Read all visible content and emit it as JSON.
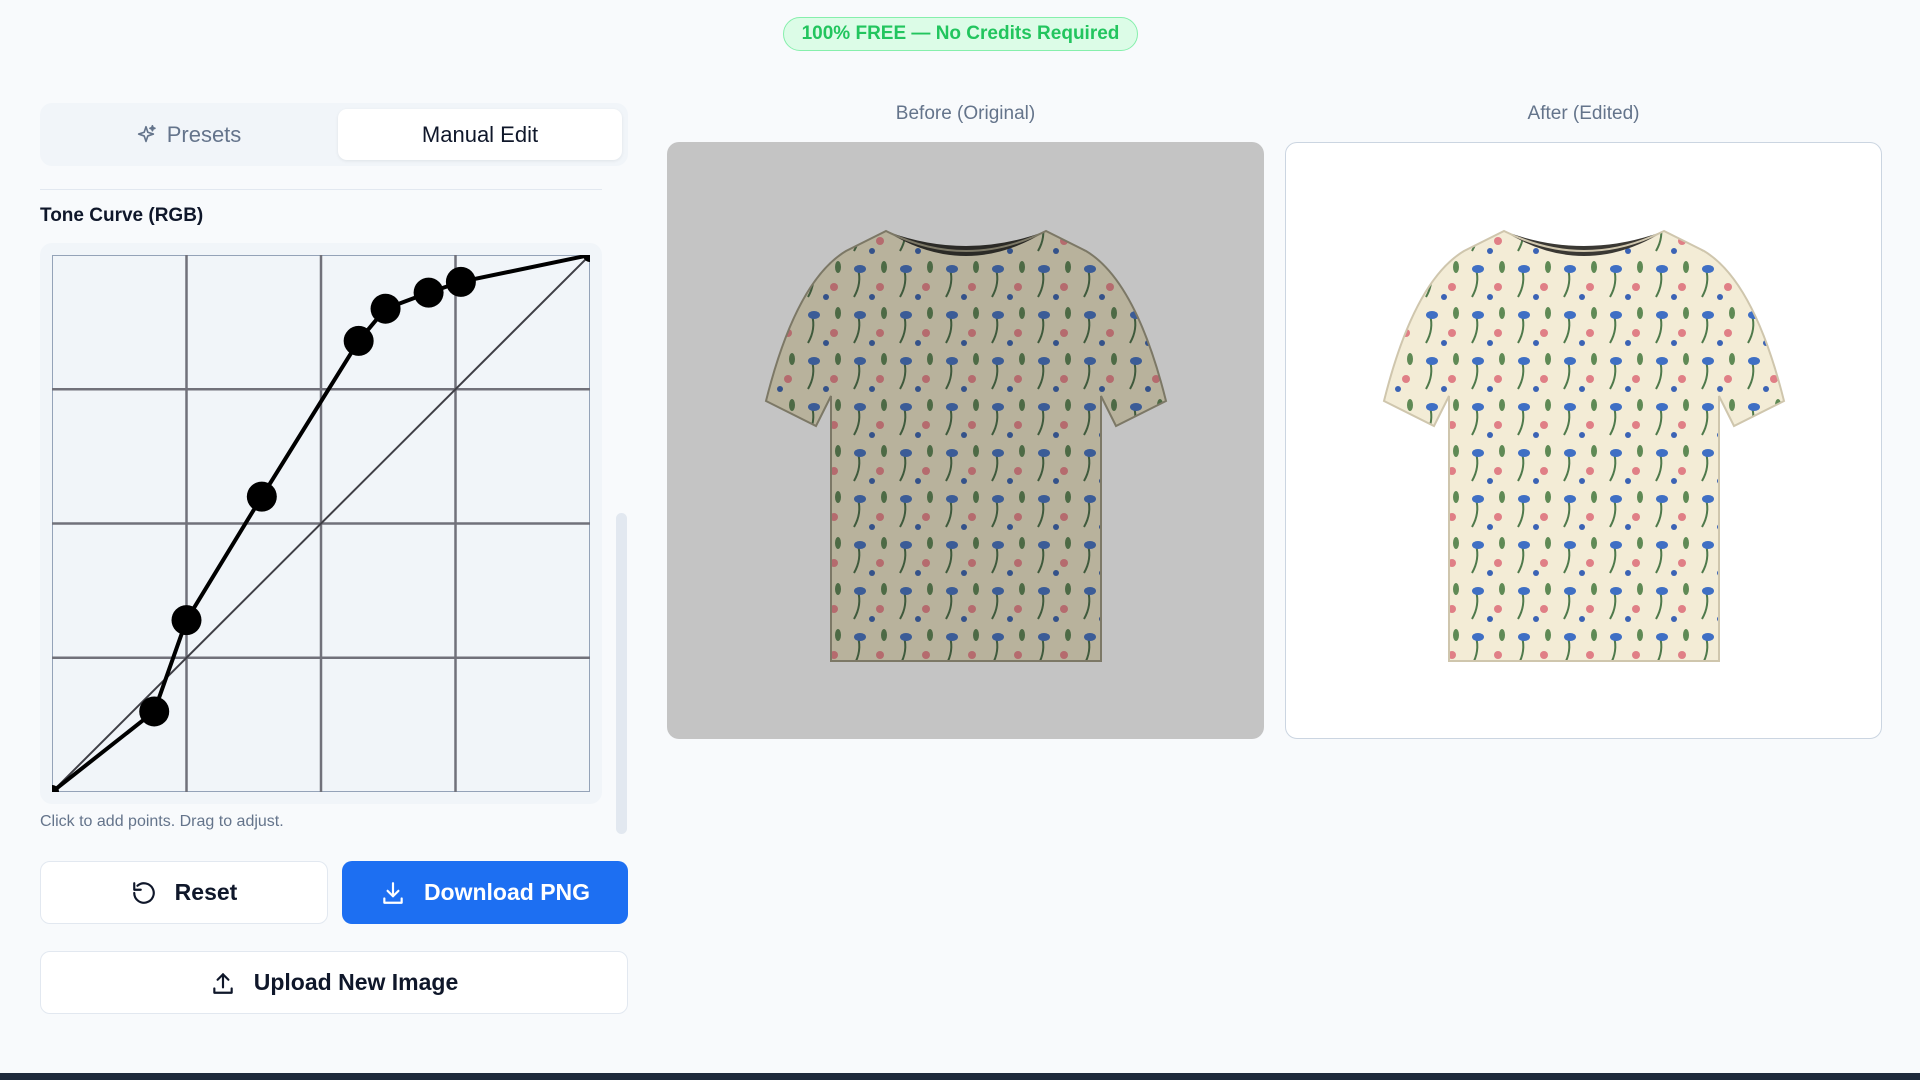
{
  "badge": {
    "text": "100% FREE — No Credits Required",
    "color": "#22c55e"
  },
  "tabs": [
    {
      "label": "Presets",
      "icon": "sparkles-icon",
      "active": false
    },
    {
      "label": "Manual Edit",
      "active": true
    }
  ],
  "tone_curve": {
    "title": "Tone Curve (RGB)",
    "hint": "Click to add points. Drag to adjust.",
    "points": [
      [
        0,
        0
      ],
      [
        0.19,
        0.15
      ],
      [
        0.25,
        0.32
      ],
      [
        0.39,
        0.55
      ],
      [
        0.57,
        0.84
      ],
      [
        0.62,
        0.9
      ],
      [
        0.7,
        0.93
      ],
      [
        0.76,
        0.95
      ],
      [
        1,
        1
      ]
    ]
  },
  "actions": {
    "reset": {
      "label": "Reset",
      "icon": "reset-icon"
    },
    "download": {
      "label": "Download PNG",
      "icon": "download-icon",
      "color": "#1d6ff2"
    },
    "upload": {
      "label": "Upload New Image",
      "icon": "upload-icon"
    }
  },
  "preview": {
    "before_label": "Before (Original)",
    "after_label": "After (Edited)"
  }
}
